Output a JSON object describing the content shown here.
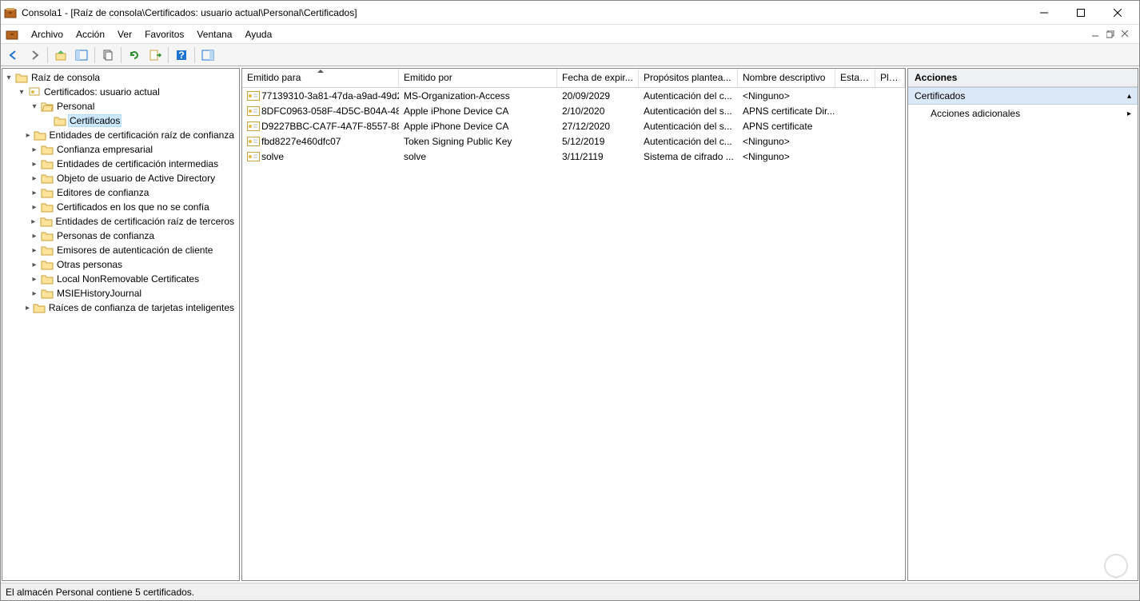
{
  "window": {
    "title": "Consola1 - [Raíz de consola\\Certificados: usuario actual\\Personal\\Certificados]"
  },
  "menu": {
    "archivo": "Archivo",
    "accion": "Acción",
    "ver": "Ver",
    "favoritos": "Favoritos",
    "ventana": "Ventana",
    "ayuda": "Ayuda"
  },
  "tree": {
    "root": "Raíz de consola",
    "cert_user": "Certificados: usuario actual",
    "personal": "Personal",
    "certificados": "Certificados",
    "nodes": [
      "Entidades de certificación raíz de confianza",
      "Confianza empresarial",
      "Entidades de certificación intermedias",
      "Objeto de usuario de Active Directory",
      "Editores de confianza",
      "Certificados en los que no se confía",
      "Entidades de certificación raíz de terceros",
      "Personas de confianza",
      "Emisores de autenticación de cliente",
      "Otras personas",
      "Local NonRemovable Certificates",
      "MSIEHistoryJournal",
      "Raíces de confianza de tarjetas inteligentes"
    ]
  },
  "columns": {
    "c0": "Emitido para",
    "c1": "Emitido por",
    "c2": "Fecha de expir...",
    "c3": "Propósitos plantea...",
    "c4": "Nombre descriptivo",
    "c5": "Estado",
    "c6": "Plan"
  },
  "rows": [
    {
      "c0": "77139310-3a81-47da-a9ad-49d2...",
      "c1": "MS-Organization-Access",
      "c2": "20/09/2029",
      "c3": "Autenticación del c...",
      "c4": "<Ninguno>"
    },
    {
      "c0": "8DFC0963-058F-4D5C-B04A-48...",
      "c1": "Apple iPhone Device CA",
      "c2": "2/10/2020",
      "c3": "Autenticación del s...",
      "c4": "APNS certificate Dir..."
    },
    {
      "c0": "D9227BBC-CA7F-4A7F-8557-88...",
      "c1": "Apple iPhone Device CA",
      "c2": "27/12/2020",
      "c3": "Autenticación del s...",
      "c4": "APNS certificate"
    },
    {
      "c0": "fbd8227e460dfc07",
      "c1": "Token Signing Public Key",
      "c2": "5/12/2019",
      "c3": "Autenticación del c...",
      "c4": "<Ninguno>"
    },
    {
      "c0": "solve",
      "c1": "solve",
      "c2": "3/11/2119",
      "c3": "Sistema de cifrado ...",
      "c4": "<Ninguno>"
    }
  ],
  "actions": {
    "header": "Acciones",
    "section": "Certificados",
    "more": "Acciones adicionales"
  },
  "status": "El almacén Personal contiene 5 certificados."
}
